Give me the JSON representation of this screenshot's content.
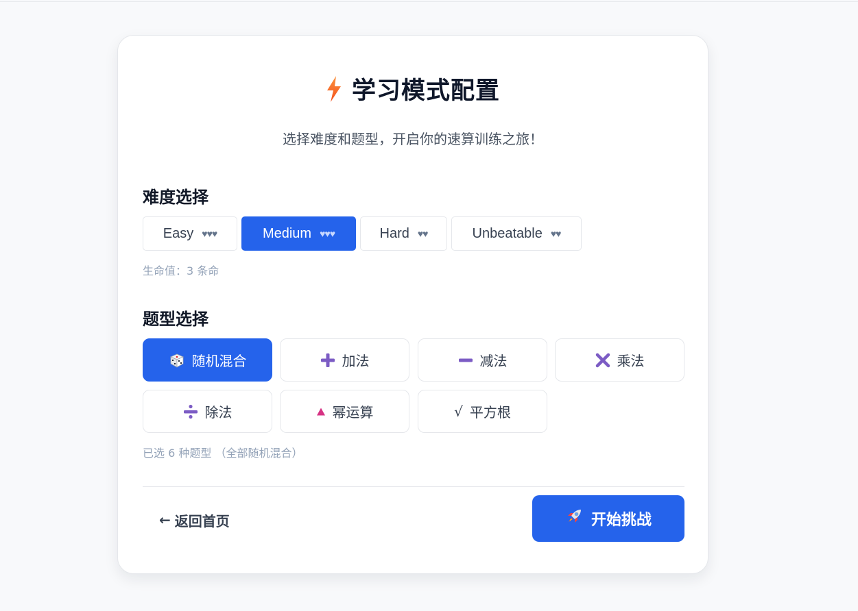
{
  "header": {
    "icon": "lightning-icon",
    "title": "学习模式配置",
    "subtitle": "选择难度和题型，开启你的速算训练之旅！"
  },
  "difficulty": {
    "section_title": "难度选择",
    "options": [
      {
        "label": "Easy",
        "hearts": "♥♥♥",
        "selected": false
      },
      {
        "label": "Medium",
        "hearts": "♥♥♥",
        "selected": true
      },
      {
        "label": "Hard",
        "hearts": "♥♥",
        "selected": false
      },
      {
        "label": "Unbeatable",
        "hearts": "♥♥",
        "selected": false
      }
    ],
    "hint": "生命值：3 条命"
  },
  "question_types": {
    "section_title": "题型选择",
    "options": [
      {
        "label": "随机混合",
        "icon": "dice-icon",
        "selected": true
      },
      {
        "label": "加法",
        "icon": "plus-icon",
        "selected": false
      },
      {
        "label": "减法",
        "icon": "minus-icon",
        "selected": false
      },
      {
        "label": "乘法",
        "icon": "multiply-icon",
        "selected": false
      },
      {
        "label": "除法",
        "icon": "divide-icon",
        "selected": false
      },
      {
        "label": "幂运算",
        "icon": "triangle-icon",
        "selected": false
      },
      {
        "label": "平方根",
        "icon": "sqrt-icon",
        "icon_glyph": "√",
        "selected": false
      }
    ],
    "hint": "已选 6 种题型 （全部随机混合）"
  },
  "footer": {
    "back_arrow": "←",
    "back_label": "返回首页",
    "start_icon": "rocket-icon",
    "start_label": "开始挑战"
  },
  "colors": {
    "accent": "#2563eb",
    "icon_purple": "#7c5cc4",
    "triangle": "#d63384",
    "page_bg": "#f8f9fb"
  }
}
